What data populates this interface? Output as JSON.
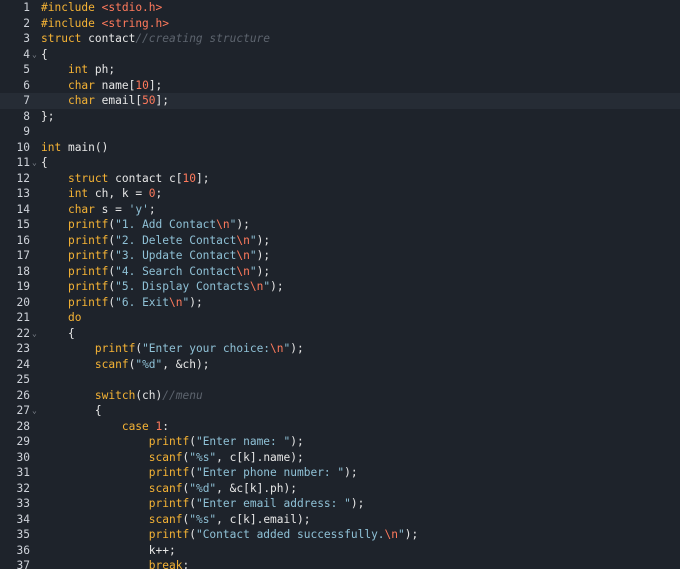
{
  "editor": {
    "lines": [
      {
        "n": "1",
        "fold": false,
        "segs": [
          {
            "t": "kw",
            "v": "#include"
          },
          {
            "t": "tx",
            "v": " "
          },
          {
            "t": "inc",
            "v": "<stdio.h>"
          }
        ]
      },
      {
        "n": "2",
        "fold": false,
        "segs": [
          {
            "t": "kw",
            "v": "#include"
          },
          {
            "t": "tx",
            "v": " "
          },
          {
            "t": "inc",
            "v": "<string.h>"
          }
        ]
      },
      {
        "n": "3",
        "fold": false,
        "segs": [
          {
            "t": "kw",
            "v": "struct"
          },
          {
            "t": "tx",
            "v": " contact"
          },
          {
            "t": "cm",
            "v": "//creating structure"
          }
        ]
      },
      {
        "n": "4",
        "fold": true,
        "segs": [
          {
            "t": "tx",
            "v": "{"
          }
        ]
      },
      {
        "n": "5",
        "fold": false,
        "segs": [
          {
            "t": "tx",
            "v": "    "
          },
          {
            "t": "ty",
            "v": "int"
          },
          {
            "t": "tx",
            "v": " ph;"
          }
        ]
      },
      {
        "n": "6",
        "fold": false,
        "segs": [
          {
            "t": "tx",
            "v": "    "
          },
          {
            "t": "ty",
            "v": "char"
          },
          {
            "t": "tx",
            "v": " name["
          },
          {
            "t": "num",
            "v": "10"
          },
          {
            "t": "tx",
            "v": "];"
          }
        ]
      },
      {
        "n": "7",
        "fold": false,
        "active": true,
        "segs": [
          {
            "t": "tx",
            "v": "    "
          },
          {
            "t": "ty",
            "v": "char"
          },
          {
            "t": "tx",
            "v": " email["
          },
          {
            "t": "num",
            "v": "50"
          },
          {
            "t": "tx",
            "v": "];"
          }
        ]
      },
      {
        "n": "8",
        "fold": false,
        "segs": [
          {
            "t": "tx",
            "v": "};"
          }
        ]
      },
      {
        "n": "9",
        "fold": false,
        "segs": []
      },
      {
        "n": "10",
        "fold": false,
        "segs": [
          {
            "t": "ty",
            "v": "int"
          },
          {
            "t": "tx",
            "v": " main()"
          }
        ]
      },
      {
        "n": "11",
        "fold": true,
        "segs": [
          {
            "t": "tx",
            "v": "{"
          }
        ]
      },
      {
        "n": "12",
        "fold": false,
        "segs": [
          {
            "t": "tx",
            "v": "    "
          },
          {
            "t": "kw",
            "v": "struct"
          },
          {
            "t": "tx",
            "v": " contact c["
          },
          {
            "t": "num",
            "v": "10"
          },
          {
            "t": "tx",
            "v": "];"
          }
        ]
      },
      {
        "n": "13",
        "fold": false,
        "segs": [
          {
            "t": "tx",
            "v": "    "
          },
          {
            "t": "ty",
            "v": "int"
          },
          {
            "t": "tx",
            "v": " ch, k = "
          },
          {
            "t": "num",
            "v": "0"
          },
          {
            "t": "tx",
            "v": ";"
          }
        ]
      },
      {
        "n": "14",
        "fold": false,
        "segs": [
          {
            "t": "tx",
            "v": "    "
          },
          {
            "t": "ty",
            "v": "char"
          },
          {
            "t": "tx",
            "v": " s = "
          },
          {
            "t": "str",
            "v": "'y'"
          },
          {
            "t": "tx",
            "v": ";"
          }
        ]
      },
      {
        "n": "15",
        "fold": false,
        "segs": [
          {
            "t": "tx",
            "v": "    "
          },
          {
            "t": "fn",
            "v": "printf"
          },
          {
            "t": "tx",
            "v": "("
          },
          {
            "t": "str",
            "v": "\"1. Add Contact"
          },
          {
            "t": "esc",
            "v": "\\n"
          },
          {
            "t": "str",
            "v": "\""
          },
          {
            "t": "tx",
            "v": ");"
          }
        ]
      },
      {
        "n": "16",
        "fold": false,
        "segs": [
          {
            "t": "tx",
            "v": "    "
          },
          {
            "t": "fn",
            "v": "printf"
          },
          {
            "t": "tx",
            "v": "("
          },
          {
            "t": "str",
            "v": "\"2. Delete Contact"
          },
          {
            "t": "esc",
            "v": "\\n"
          },
          {
            "t": "str",
            "v": "\""
          },
          {
            "t": "tx",
            "v": ");"
          }
        ]
      },
      {
        "n": "17",
        "fold": false,
        "segs": [
          {
            "t": "tx",
            "v": "    "
          },
          {
            "t": "fn",
            "v": "printf"
          },
          {
            "t": "tx",
            "v": "("
          },
          {
            "t": "str",
            "v": "\"3. Update Contact"
          },
          {
            "t": "esc",
            "v": "\\n"
          },
          {
            "t": "str",
            "v": "\""
          },
          {
            "t": "tx",
            "v": ");"
          }
        ]
      },
      {
        "n": "18",
        "fold": false,
        "segs": [
          {
            "t": "tx",
            "v": "    "
          },
          {
            "t": "fn",
            "v": "printf"
          },
          {
            "t": "tx",
            "v": "("
          },
          {
            "t": "str",
            "v": "\"4. Search Contact"
          },
          {
            "t": "esc",
            "v": "\\n"
          },
          {
            "t": "str",
            "v": "\""
          },
          {
            "t": "tx",
            "v": ");"
          }
        ]
      },
      {
        "n": "19",
        "fold": false,
        "segs": [
          {
            "t": "tx",
            "v": "    "
          },
          {
            "t": "fn",
            "v": "printf"
          },
          {
            "t": "tx",
            "v": "("
          },
          {
            "t": "str",
            "v": "\"5. Display Contacts"
          },
          {
            "t": "esc",
            "v": "\\n"
          },
          {
            "t": "str",
            "v": "\""
          },
          {
            "t": "tx",
            "v": ");"
          }
        ]
      },
      {
        "n": "20",
        "fold": false,
        "segs": [
          {
            "t": "tx",
            "v": "    "
          },
          {
            "t": "fn",
            "v": "printf"
          },
          {
            "t": "tx",
            "v": "("
          },
          {
            "t": "str",
            "v": "\"6. Exit"
          },
          {
            "t": "esc",
            "v": "\\n"
          },
          {
            "t": "str",
            "v": "\""
          },
          {
            "t": "tx",
            "v": ");"
          }
        ]
      },
      {
        "n": "21",
        "fold": false,
        "segs": [
          {
            "t": "tx",
            "v": "    "
          },
          {
            "t": "kw",
            "v": "do"
          }
        ]
      },
      {
        "n": "22",
        "fold": true,
        "segs": [
          {
            "t": "tx",
            "v": "    {"
          }
        ]
      },
      {
        "n": "23",
        "fold": false,
        "segs": [
          {
            "t": "tx",
            "v": "        "
          },
          {
            "t": "fn",
            "v": "printf"
          },
          {
            "t": "tx",
            "v": "("
          },
          {
            "t": "str",
            "v": "\"Enter your choice:"
          },
          {
            "t": "esc",
            "v": "\\n"
          },
          {
            "t": "str",
            "v": "\""
          },
          {
            "t": "tx",
            "v": ");"
          }
        ]
      },
      {
        "n": "24",
        "fold": false,
        "segs": [
          {
            "t": "tx",
            "v": "        "
          },
          {
            "t": "fn",
            "v": "scanf"
          },
          {
            "t": "tx",
            "v": "("
          },
          {
            "t": "str",
            "v": "\"%d\""
          },
          {
            "t": "tx",
            "v": ", &ch);"
          }
        ]
      },
      {
        "n": "25",
        "fold": false,
        "segs": []
      },
      {
        "n": "26",
        "fold": false,
        "segs": [
          {
            "t": "tx",
            "v": "        "
          },
          {
            "t": "kw",
            "v": "switch"
          },
          {
            "t": "tx",
            "v": "(ch)"
          },
          {
            "t": "cm",
            "v": "//menu"
          }
        ]
      },
      {
        "n": "27",
        "fold": true,
        "segs": [
          {
            "t": "tx",
            "v": "        {"
          }
        ]
      },
      {
        "n": "28",
        "fold": false,
        "segs": [
          {
            "t": "tx",
            "v": "            "
          },
          {
            "t": "kw",
            "v": "case"
          },
          {
            "t": "tx",
            "v": " "
          },
          {
            "t": "num",
            "v": "1"
          },
          {
            "t": "tx",
            "v": ":"
          }
        ]
      },
      {
        "n": "29",
        "fold": false,
        "segs": [
          {
            "t": "tx",
            "v": "                "
          },
          {
            "t": "fn",
            "v": "printf"
          },
          {
            "t": "tx",
            "v": "("
          },
          {
            "t": "str",
            "v": "\"Enter name: \""
          },
          {
            "t": "tx",
            "v": ");"
          }
        ]
      },
      {
        "n": "30",
        "fold": false,
        "segs": [
          {
            "t": "tx",
            "v": "                "
          },
          {
            "t": "fn",
            "v": "scanf"
          },
          {
            "t": "tx",
            "v": "("
          },
          {
            "t": "str",
            "v": "\"%s\""
          },
          {
            "t": "tx",
            "v": ", c[k].name);"
          }
        ]
      },
      {
        "n": "31",
        "fold": false,
        "segs": [
          {
            "t": "tx",
            "v": "                "
          },
          {
            "t": "fn",
            "v": "printf"
          },
          {
            "t": "tx",
            "v": "("
          },
          {
            "t": "str",
            "v": "\"Enter phone number: \""
          },
          {
            "t": "tx",
            "v": ");"
          }
        ]
      },
      {
        "n": "32",
        "fold": false,
        "segs": [
          {
            "t": "tx",
            "v": "                "
          },
          {
            "t": "fn",
            "v": "scanf"
          },
          {
            "t": "tx",
            "v": "("
          },
          {
            "t": "str",
            "v": "\"%d\""
          },
          {
            "t": "tx",
            "v": ", &c[k].ph);"
          }
        ]
      },
      {
        "n": "33",
        "fold": false,
        "segs": [
          {
            "t": "tx",
            "v": "                "
          },
          {
            "t": "fn",
            "v": "printf"
          },
          {
            "t": "tx",
            "v": "("
          },
          {
            "t": "str",
            "v": "\"Enter email address: \""
          },
          {
            "t": "tx",
            "v": ");"
          }
        ]
      },
      {
        "n": "34",
        "fold": false,
        "segs": [
          {
            "t": "tx",
            "v": "                "
          },
          {
            "t": "fn",
            "v": "scanf"
          },
          {
            "t": "tx",
            "v": "("
          },
          {
            "t": "str",
            "v": "\"%s\""
          },
          {
            "t": "tx",
            "v": ", c[k].email);"
          }
        ]
      },
      {
        "n": "35",
        "fold": false,
        "segs": [
          {
            "t": "tx",
            "v": "                "
          },
          {
            "t": "fn",
            "v": "printf"
          },
          {
            "t": "tx",
            "v": "("
          },
          {
            "t": "str",
            "v": "\"Contact added successfully."
          },
          {
            "t": "esc",
            "v": "\\n"
          },
          {
            "t": "str",
            "v": "\""
          },
          {
            "t": "tx",
            "v": ");"
          }
        ]
      },
      {
        "n": "36",
        "fold": false,
        "segs": [
          {
            "t": "tx",
            "v": "                k++;"
          }
        ]
      },
      {
        "n": "37",
        "fold": false,
        "segs": [
          {
            "t": "tx",
            "v": "                "
          },
          {
            "t": "kw",
            "v": "break"
          },
          {
            "t": "tx",
            "v": ";"
          }
        ]
      }
    ]
  },
  "colors": {
    "background": "#1e232b",
    "active_line": "#262c35",
    "keyword": "#f5b335",
    "string": "#8fc1d6",
    "number": "#ff7a5c",
    "comment": "#5d646e",
    "text": "#e6e6e6"
  }
}
